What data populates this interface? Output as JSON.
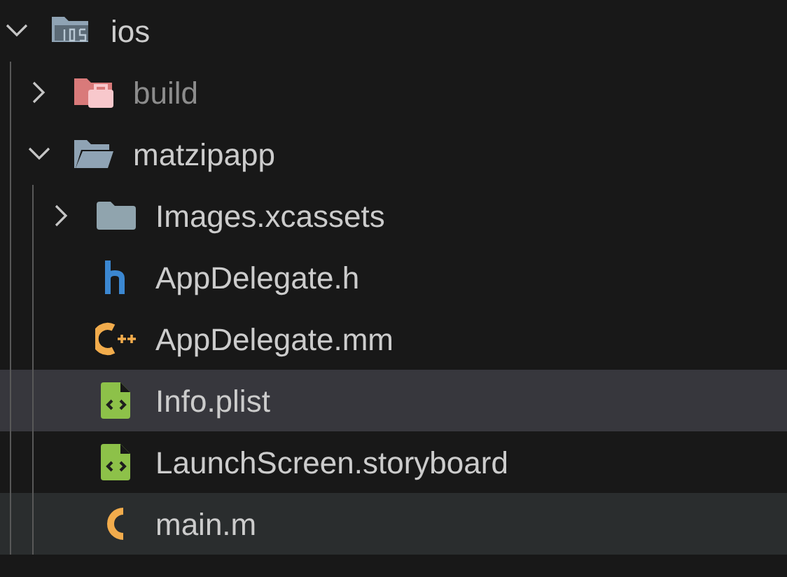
{
  "tree": [
    {
      "label": "ios",
      "kind": "folder-ios",
      "expanded": true,
      "selected": false,
      "hovered": false,
      "ignored": false,
      "children": [
        {
          "label": "build",
          "kind": "folder-build",
          "expanded": false,
          "selected": false,
          "hovered": false,
          "ignored": true
        },
        {
          "label": "matzipapp",
          "kind": "folder",
          "expanded": true,
          "selected": false,
          "hovered": false,
          "ignored": false,
          "children": [
            {
              "label": "Images.xcassets",
              "kind": "folder",
              "expanded": false,
              "selected": false,
              "hovered": false,
              "ignored": false
            },
            {
              "label": "AppDelegate.h",
              "kind": "header",
              "selected": false,
              "hovered": false,
              "ignored": false
            },
            {
              "label": "AppDelegate.mm",
              "kind": "cpp",
              "selected": false,
              "hovered": false,
              "ignored": false
            },
            {
              "label": "Info.plist",
              "kind": "xml",
              "selected": true,
              "hovered": false,
              "ignored": false
            },
            {
              "label": "LaunchScreen.storyboard",
              "kind": "xml",
              "selected": false,
              "hovered": false,
              "ignored": false
            },
            {
              "label": "main.m",
              "kind": "c",
              "selected": false,
              "hovered": true,
              "ignored": false
            }
          ]
        }
      ]
    }
  ]
}
